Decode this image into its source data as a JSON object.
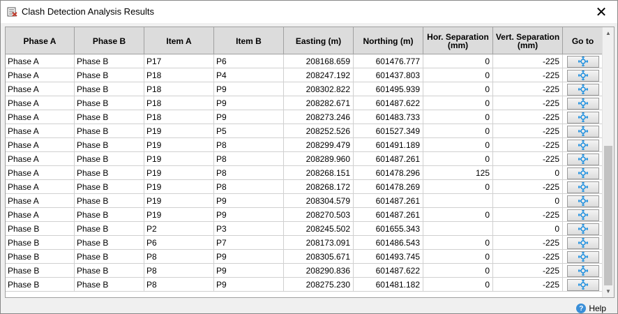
{
  "window": {
    "title": "Clash Detection Analysis Results",
    "close_label": "✕"
  },
  "table": {
    "columns": [
      "Phase A",
      "Phase B",
      "Item A",
      "Item B",
      "Easting (m)",
      "Northing (m)",
      "Hor. Separation (mm)",
      "Vert. Separation (mm)",
      "Go to"
    ],
    "rows": [
      [
        "Phase A",
        "Phase B",
        "P17",
        "P6",
        "208168.659",
        "601476.777",
        "0",
        "-225"
      ],
      [
        "Phase A",
        "Phase B",
        "P18",
        "P4",
        "208247.192",
        "601437.803",
        "0",
        "-225"
      ],
      [
        "Phase A",
        "Phase B",
        "P18",
        "P9",
        "208302.822",
        "601495.939",
        "0",
        "-225"
      ],
      [
        "Phase A",
        "Phase B",
        "P18",
        "P9",
        "208282.671",
        "601487.622",
        "0",
        "-225"
      ],
      [
        "Phase A",
        "Phase B",
        "P18",
        "P9",
        "208273.246",
        "601483.733",
        "0",
        "-225"
      ],
      [
        "Phase A",
        "Phase B",
        "P19",
        "P5",
        "208252.526",
        "601527.349",
        "0",
        "-225"
      ],
      [
        "Phase A",
        "Phase B",
        "P19",
        "P8",
        "208299.479",
        "601491.189",
        "0",
        "-225"
      ],
      [
        "Phase A",
        "Phase B",
        "P19",
        "P8",
        "208289.960",
        "601487.261",
        "0",
        "-225"
      ],
      [
        "Phase A",
        "Phase B",
        "P19",
        "P8",
        "208268.151",
        "601478.296",
        "125",
        "0"
      ],
      [
        "Phase A",
        "Phase B",
        "P19",
        "P8",
        "208268.172",
        "601478.269",
        "0",
        "-225"
      ],
      [
        "Phase A",
        "Phase B",
        "P19",
        "P9",
        "208304.579",
        "601487.261",
        "",
        "0"
      ],
      [
        "Phase A",
        "Phase B",
        "P19",
        "P9",
        "208270.503",
        "601487.261",
        "0",
        "-225"
      ],
      [
        "Phase B",
        "Phase B",
        "P2",
        "P3",
        "208245.502",
        "601655.343",
        "",
        "0"
      ],
      [
        "Phase B",
        "Phase B",
        "P6",
        "P7",
        "208173.091",
        "601486.543",
        "0",
        "-225"
      ],
      [
        "Phase B",
        "Phase B",
        "P8",
        "P9",
        "208305.671",
        "601493.745",
        "0",
        "-225"
      ],
      [
        "Phase B",
        "Phase B",
        "P8",
        "P9",
        "208290.836",
        "601487.622",
        "0",
        "-225"
      ],
      [
        "Phase B",
        "Phase B",
        "P8",
        "P9",
        "208275.230",
        "601481.182",
        "0",
        "-225"
      ]
    ]
  },
  "footer": {
    "help_label": "Help"
  },
  "icons": {
    "title": "clash-results-icon",
    "goto": "target-crosshair-icon",
    "help": "help-icon"
  },
  "colors": {
    "header_bg": "#dcdcdc",
    "goto_icon": "#1e90e0"
  }
}
